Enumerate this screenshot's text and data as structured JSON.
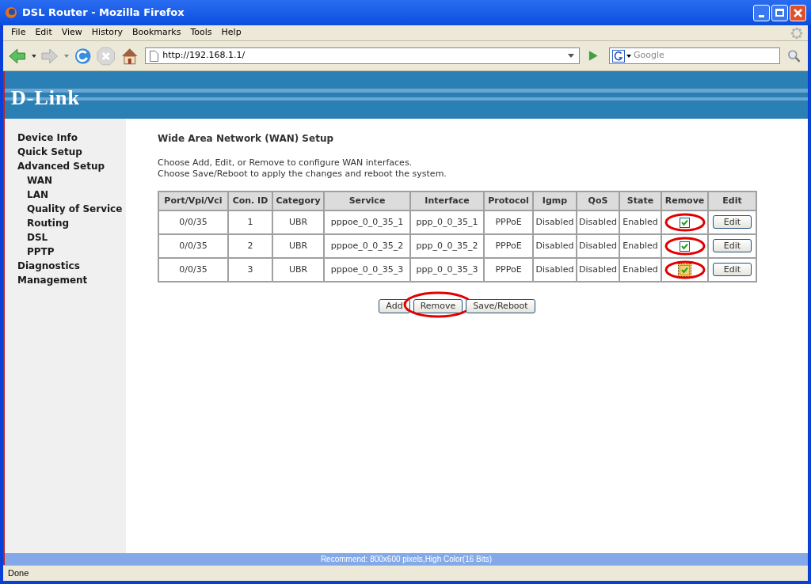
{
  "window": {
    "title": "DSL Router - Mozilla Firefox"
  },
  "menu": [
    "File",
    "Edit",
    "View",
    "History",
    "Bookmarks",
    "Tools",
    "Help"
  ],
  "address_bar": {
    "value": "http://192.168.1.1/"
  },
  "search": {
    "placeholder": "Google"
  },
  "banner": {
    "logo": "D-Link"
  },
  "sidebar": {
    "items": [
      {
        "label": "Device Info"
      },
      {
        "label": "Quick Setup"
      },
      {
        "label": "Advanced Setup",
        "children": [
          {
            "label": "WAN"
          },
          {
            "label": "LAN"
          },
          {
            "label": "Quality of Service"
          },
          {
            "label": "Routing"
          },
          {
            "label": "DSL"
          },
          {
            "label": "PPTP"
          }
        ]
      },
      {
        "label": "Diagnostics"
      },
      {
        "label": "Management"
      }
    ]
  },
  "content": {
    "heading": "Wide Area Network (WAN) Setup",
    "instructions": [
      "Choose Add, Edit, or Remove to configure WAN interfaces.",
      "Choose Save/Reboot to apply the changes and reboot the system."
    ]
  },
  "table": {
    "columns": [
      "Port/Vpi/Vci",
      "Con. ID",
      "Category",
      "Service",
      "Interface",
      "Protocol",
      "Igmp",
      "QoS",
      "State",
      "Remove",
      "Edit"
    ],
    "rows": [
      {
        "cells": [
          "0/0/35",
          "1",
          "UBR",
          "pppoe_0_0_35_1",
          "ppp_0_0_35_1",
          "PPPoE",
          "Disabled",
          "Disabled",
          "Enabled"
        ],
        "remove_checked": true,
        "focused": false,
        "circled": true,
        "edit": "Edit"
      },
      {
        "cells": [
          "0/0/35",
          "2",
          "UBR",
          "pppoe_0_0_35_2",
          "ppp_0_0_35_2",
          "PPPoE",
          "Disabled",
          "Disabled",
          "Enabled"
        ],
        "remove_checked": true,
        "focused": false,
        "circled": true,
        "edit": "Edit"
      },
      {
        "cells": [
          "0/0/35",
          "3",
          "UBR",
          "pppoe_0_0_35_3",
          "ppp_0_0_35_3",
          "PPPoE",
          "Disabled",
          "Disabled",
          "Enabled"
        ],
        "remove_checked": true,
        "focused": true,
        "circled": true,
        "edit": "Edit"
      }
    ]
  },
  "buttons": [
    {
      "label": "Add",
      "circled": false
    },
    {
      "label": "Remove",
      "circled": true
    },
    {
      "label": "Save/Reboot",
      "circled": false
    }
  ],
  "footer": "Recommend: 800x600 pixels,High Color(16 Bits)",
  "status_bar": "Done"
}
